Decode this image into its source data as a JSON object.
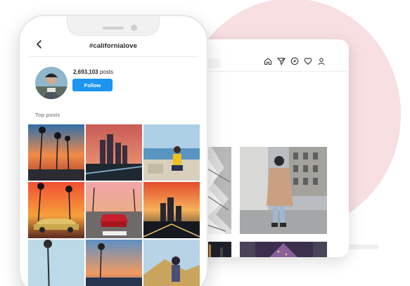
{
  "header": {
    "hashtag": "#californialove"
  },
  "profile": {
    "posts_number": "2,693,103",
    "posts_word": " posts",
    "follow_label": "Follow"
  },
  "sections": {
    "top_posts": "Top posts"
  },
  "colors": {
    "follow_button": "#1b95f0",
    "backdrop_circle": "#f7dfe2"
  },
  "icons": {
    "back": "chevron-left-icon",
    "tablet_nav": [
      "home-icon",
      "direct-send-icon",
      "explore-compass-icon",
      "heart-icon",
      "profile-icon"
    ]
  }
}
